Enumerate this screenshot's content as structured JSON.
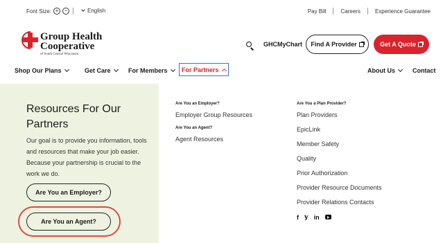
{
  "topbar": {
    "font_size_label": "Font Size:",
    "increase_symbol": "+",
    "decrease_symbol": "−",
    "language": "English",
    "pay_bill": "Pay Bill",
    "careers": "Careers",
    "experience_guarantee": "Experience Guarantee"
  },
  "brand": {
    "name_line1": "Group Health",
    "name_line2": "Cooperative",
    "tagline": "of South Central Wisconsin",
    "accent_color": "#d9232d"
  },
  "header": {
    "mychart": "GHCMyChart",
    "find_provider": "Find A Provider",
    "get_quote": "Get A Quote"
  },
  "nav": {
    "shop_plans": "Shop Our Plans",
    "get_care": "Get Care",
    "for_members": "For Members",
    "for_partners": "For Partners",
    "about_us": "About Us",
    "contact": "Contact"
  },
  "partners_panel": {
    "title": "Resources For Our Partners",
    "description": "Our goal is to provide you information, tools and resources that make your job easier. Because your partnership is crucial to the work we do.",
    "employer_button": "Are You an Employer?",
    "agent_button": "Are You an Agent?",
    "panel_color": "#eef3e1"
  },
  "columns": {
    "employer_heading": "Are You an Employer?",
    "employer_links": [
      "Employer Group Resources"
    ],
    "agent_heading": "Are You an Agent?",
    "agent_links": [
      "Agent Resources"
    ],
    "provider_heading": "Are You a Plan Provider?",
    "provider_links": [
      "Plan Providers",
      "EpicLink",
      "Member Safety",
      "Quality",
      "Prior Authorization",
      "Provider Resource Documents",
      "Provider Relations Contacts"
    ]
  },
  "social": {
    "facebook": "f",
    "twitter": "𝕪",
    "linkedin": "in"
  }
}
